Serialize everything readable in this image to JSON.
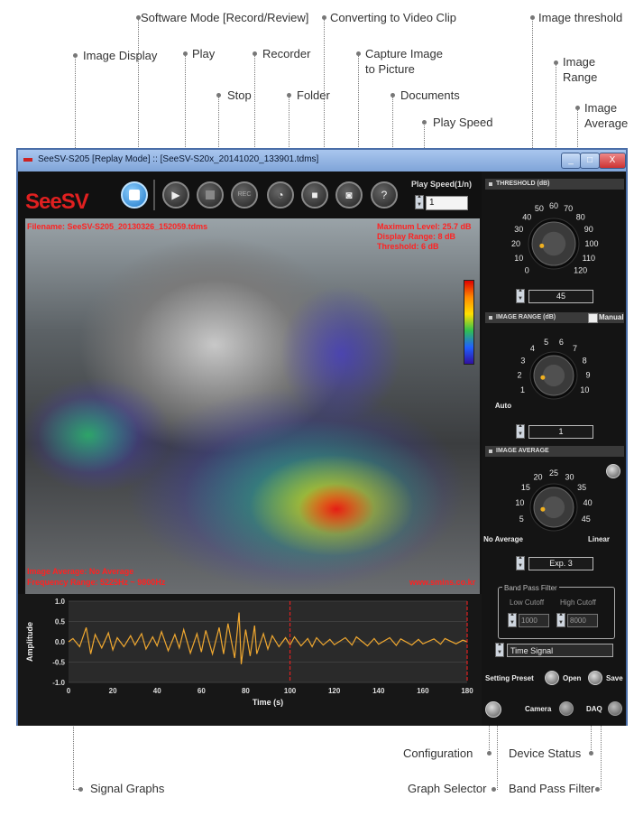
{
  "callouts": {
    "software_mode": "Software Mode [Record/Review]",
    "converting": "Converting to Video Clip",
    "image_threshold": "Image threshold",
    "image_display": "Image Display",
    "play": "Play",
    "recorder": "Recorder",
    "capture_line1": "Capture Image",
    "capture_line2": "to Picture",
    "image_range_line1": "Image",
    "image_range_line2": "Range",
    "stop": "Stop",
    "folder": "Folder",
    "documents": "Documents",
    "image_average_line1": "Image",
    "image_average_line2": "Average",
    "play_speed": "Play Speed",
    "configuration": "Configuration",
    "device_status": "Device Status",
    "signal_graphs": "Signal Graphs",
    "graph_selector": "Graph Selector",
    "band_pass_filter": "Band Pass Filter"
  },
  "window": {
    "title": "SeeSV-S205 [Replay Mode] :: [SeeSV-S20x_20141020_133901.tdms]",
    "min": "_",
    "max": "□",
    "close": "X"
  },
  "toolbar": {
    "logo": "SeeSV",
    "rec_label": "REC",
    "documents_glyph": "?",
    "play_speed_label": "Play Speed(1/n)",
    "play_speed_value": "1"
  },
  "image_display": {
    "filename": "Filename: SeeSV-S205_20130326_152059.tdms",
    "max_level": "Maximum Level: 25.7 dB",
    "display_range": "Display Range: 8 dB",
    "threshold": "Threshold: 6 dB",
    "image_average": "Image Average: No Average",
    "freq_range": "Frequency Range: 5225Hz ~ 9800Hz",
    "website": "www.smins.co.kr"
  },
  "threshold_panel": {
    "header": "THRESHOLD (dB)",
    "ticks": [
      "0",
      "10",
      "20",
      "30",
      "40",
      "50",
      "60",
      "70",
      "80",
      "90",
      "100",
      "110",
      "120"
    ],
    "value": "45"
  },
  "range_panel": {
    "header": "IMAGE RANGE (dB)",
    "manual": "Manual",
    "ticks": [
      "1",
      "2",
      "3",
      "4",
      "5",
      "6",
      "7",
      "8",
      "9",
      "10"
    ],
    "auto": "Auto",
    "value": "1"
  },
  "average_panel": {
    "header": "IMAGE AVERAGE",
    "ticks": [
      "5",
      "10",
      "15",
      "20",
      "25",
      "30",
      "35",
      "40",
      "45"
    ],
    "no_average": "No Average",
    "linear": "Linear",
    "value": "Exp. 3"
  },
  "band_pass": {
    "legend": "Band Pass Filter",
    "low_label": "Low Cutoff",
    "high_label": "High Cutoff",
    "low_value": "1000",
    "high_value": "8000"
  },
  "graph_selector": {
    "value": "Time Signal"
  },
  "preset": {
    "label": "Setting Preset",
    "open": "Open",
    "save": "Save"
  },
  "status": {
    "camera": "Camera",
    "daq": "DAQ"
  },
  "chart_data": {
    "type": "line",
    "xlabel": "Time (s)",
    "ylabel": "Amplitude",
    "xlim": [
      0,
      180
    ],
    "ylim": [
      -1.0,
      1.0
    ],
    "x_ticks": [
      "0",
      "20",
      "40",
      "60",
      "80",
      "100",
      "120",
      "140",
      "160",
      "180"
    ],
    "y_ticks": [
      "1.0",
      "0.5",
      "0.0",
      "-0.5",
      "-1.0"
    ],
    "markers_x": [
      100,
      180
    ],
    "colors": {
      "signal": "#f0a830",
      "marker": "#e02020"
    },
    "series": [
      {
        "x": [
          0,
          2,
          5,
          8,
          10,
          12,
          15,
          18,
          20,
          22,
          25,
          28,
          30,
          33,
          35,
          38,
          40,
          42,
          45,
          48,
          50,
          52,
          55,
          58,
          60,
          62,
          65,
          68,
          70,
          72,
          75,
          77,
          78,
          80,
          82,
          84,
          85,
          88,
          90,
          92,
          95,
          98,
          100,
          102,
          105,
          108,
          110,
          112,
          115,
          118,
          120,
          125,
          128,
          130,
          135,
          138,
          140,
          145,
          148,
          150,
          155,
          158,
          160,
          165,
          168,
          170,
          175,
          178,
          180
        ],
        "values": [
          0.0,
          0.08,
          -0.12,
          0.35,
          -0.3,
          0.18,
          -0.15,
          0.22,
          -0.2,
          0.1,
          -0.12,
          0.15,
          -0.08,
          0.2,
          -0.18,
          0.12,
          -0.1,
          0.25,
          -0.22,
          0.18,
          -0.15,
          0.3,
          -0.28,
          0.2,
          -0.25,
          0.28,
          -0.3,
          0.35,
          -0.3,
          0.45,
          -0.4,
          0.72,
          -0.55,
          0.3,
          -0.35,
          0.4,
          -0.3,
          0.2,
          -0.18,
          0.15,
          -0.12,
          0.1,
          -0.08,
          0.12,
          -0.1,
          0.08,
          -0.12,
          0.1,
          -0.08,
          0.06,
          -0.07,
          0.1,
          -0.08,
          0.12,
          -0.1,
          0.08,
          -0.06,
          0.1,
          -0.09,
          0.07,
          -0.08,
          0.06,
          -0.05,
          0.07,
          -0.06,
          0.08,
          -0.05,
          0.04,
          0.0
        ]
      }
    ]
  }
}
